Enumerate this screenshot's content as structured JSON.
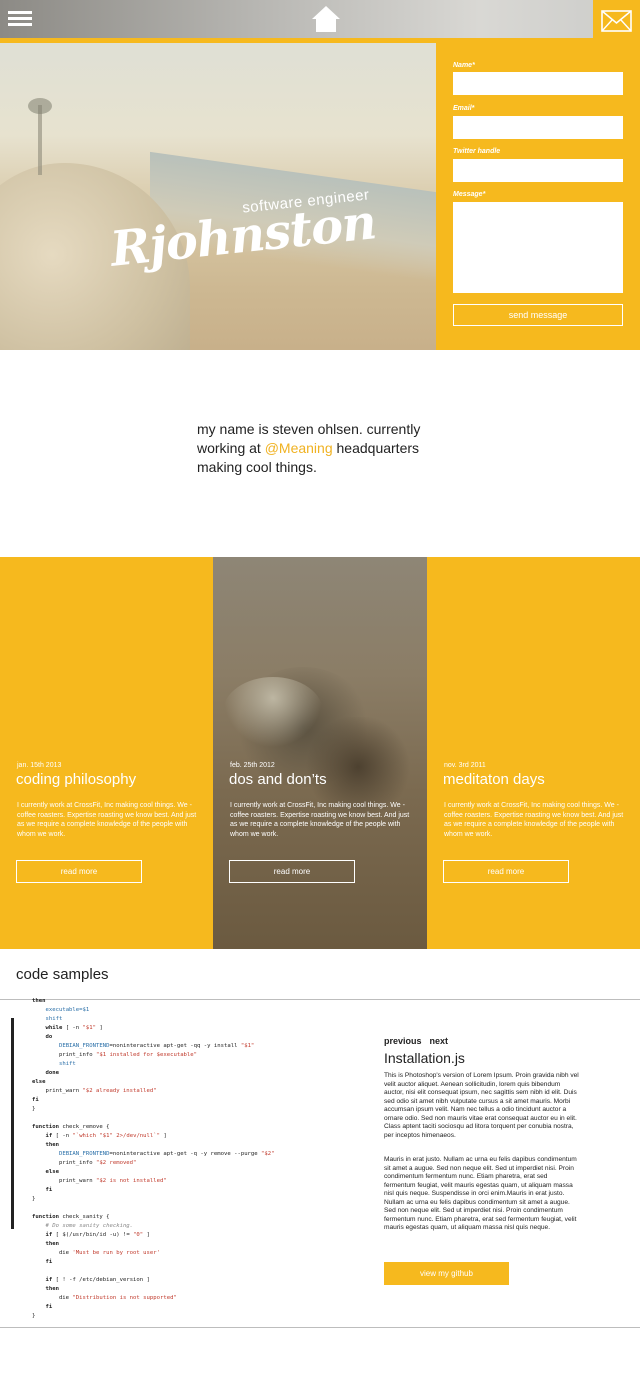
{
  "colors": {
    "accent": "#f6b91e",
    "mention": "#f0b222"
  },
  "topbar": {
    "menu_icon": "hamburger-icon",
    "home_icon": "home-icon",
    "mail_icon": "envelope-icon"
  },
  "hero": {
    "logo_name": "Rjohnston",
    "logo_subtitle": "software engineer"
  },
  "contact_form": {
    "name_label": "Name*",
    "email_label": "Email*",
    "twitter_label": "Twitter handle",
    "message_label": "Message*",
    "name_value": "",
    "email_value": "",
    "twitter_value": "",
    "message_value": "",
    "send_label": "send message"
  },
  "intro": {
    "text_before": "my name is steven ohlsen. currently working at ",
    "mention": "@Meaning",
    "text_after": " headquarters making cool things."
  },
  "posts": [
    {
      "date": "jan. 15th 2013",
      "title": "coding philosophy",
      "text": "I currently work at CrossFit, Inc making cool things. We - coffee roasters. Expertise roasting we know best. And just as we require a complete knowledge of the people with whom we work.",
      "button": "read more"
    },
    {
      "date": "feb. 25th 2012",
      "title": "dos and don’ts",
      "text": "I currently work at CrossFit, Inc making cool things. We - coffee roasters. Expertise roasting we know best. And just as we require a complete knowledge of the people with whom we work.",
      "button": "read more"
    },
    {
      "date": "nov. 3rd 2011",
      "title": "meditaton days",
      "text": "I currently work at CrossFit, Inc making cool things. We - coffee roasters. Expertise roasting we know best. And just as we require a complete knowledge of the people with whom we work.",
      "button": "read more"
    }
  ],
  "code_samples": {
    "heading": "code samples",
    "lines": [
      [
        [
          "kw",
          "then"
        ]
      ],
      [
        [
          "",
          "    "
        ],
        [
          "var",
          "executable=$1"
        ]
      ],
      [
        [
          "",
          "    "
        ],
        [
          "var",
          "shift"
        ]
      ],
      [
        [
          "",
          "    "
        ],
        [
          "kw",
          "while"
        ],
        [
          "",
          " [ -n "
        ],
        [
          "str",
          "\"$1\""
        ],
        [
          "",
          " ]"
        ]
      ],
      [
        [
          "",
          "    "
        ],
        [
          "kw",
          "do"
        ]
      ],
      [
        [
          "",
          "        "
        ],
        [
          "var",
          "DEBIAN_FRONTEND"
        ],
        [
          "",
          "=noninteractive apt-get -qq -y install "
        ],
        [
          "str",
          "\"$1\""
        ]
      ],
      [
        [
          "",
          "        print_info "
        ],
        [
          "str",
          "\"$1 installed for $executable\""
        ]
      ],
      [
        [
          "",
          "        "
        ],
        [
          "var",
          "shift"
        ]
      ],
      [
        [
          "",
          "    "
        ],
        [
          "kw",
          "done"
        ]
      ],
      [
        [
          "kw",
          "else"
        ]
      ],
      [
        [
          "",
          "    print_warn "
        ],
        [
          "str",
          "\"$2 already installed\""
        ]
      ],
      [
        [
          "kw",
          "fi"
        ]
      ],
      [
        [
          "",
          "}"
        ]
      ],
      [
        [
          "",
          ""
        ]
      ],
      [
        [
          "kw",
          "function"
        ],
        [
          "",
          " check_remove {"
        ]
      ],
      [
        [
          "",
          "    "
        ],
        [
          "kw",
          "if"
        ],
        [
          "",
          " [ -n "
        ],
        [
          "str",
          "\"`which \"$1\" 2>/dev/null`\""
        ],
        [
          "",
          " ]"
        ]
      ],
      [
        [
          "",
          "    "
        ],
        [
          "kw",
          "then"
        ]
      ],
      [
        [
          "",
          "        "
        ],
        [
          "var",
          "DEBIAN_FRONTEND"
        ],
        [
          "",
          "=noninteractive apt-get -q -y remove --purge "
        ],
        [
          "str",
          "\"$2\""
        ]
      ],
      [
        [
          "",
          "        print_info "
        ],
        [
          "str",
          "\"$2 removed\""
        ]
      ],
      [
        [
          "",
          "    "
        ],
        [
          "kw",
          "else"
        ]
      ],
      [
        [
          "",
          "        print_warn "
        ],
        [
          "str",
          "\"$2 is not installed\""
        ]
      ],
      [
        [
          "",
          "    "
        ],
        [
          "kw",
          "fi"
        ]
      ],
      [
        [
          "",
          "}"
        ]
      ],
      [
        [
          "",
          ""
        ]
      ],
      [
        [
          "kw",
          "function"
        ],
        [
          "",
          " check_sanity {"
        ]
      ],
      [
        [
          "",
          "    "
        ],
        [
          "cm",
          "# Do some sanity checking."
        ]
      ],
      [
        [
          "",
          "    "
        ],
        [
          "kw",
          "if"
        ],
        [
          "",
          " [ $(/usr/bin/id -u) != "
        ],
        [
          "str",
          "\"0\""
        ],
        [
          "",
          " ]"
        ]
      ],
      [
        [
          "",
          "    "
        ],
        [
          "kw",
          "then"
        ]
      ],
      [
        [
          "",
          "        die "
        ],
        [
          "str",
          "'Must be run by root user'"
        ]
      ],
      [
        [
          "",
          "    "
        ],
        [
          "kw",
          "fi"
        ]
      ],
      [
        [
          "",
          ""
        ]
      ],
      [
        [
          "",
          "    "
        ],
        [
          "kw",
          "if"
        ],
        [
          "",
          " [ ! -f /etc/debian_version ]"
        ]
      ],
      [
        [
          "",
          "    "
        ],
        [
          "kw",
          "then"
        ]
      ],
      [
        [
          "",
          "        die "
        ],
        [
          "str",
          "\"Distribution is not supported\""
        ]
      ],
      [
        [
          "",
          "    "
        ],
        [
          "kw",
          "fi"
        ]
      ],
      [
        [
          "",
          "}"
        ]
      ]
    ]
  },
  "doc": {
    "prev_label": "previous",
    "next_label": "next",
    "title": "Installation.js",
    "para1": "This is Photoshop's version  of Lorem Ipsum. Proin gravida nibh vel velit auctor aliquet. Aenean sollicitudin, lorem quis bibendum auctor, nisi elit consequat ipsum, nec sagittis sem nibh id elit. Duis sed odio sit amet nibh vulputate cursus a sit amet mauris. Morbi accumsan ipsum velit. Nam nec tellus a odio tincidunt auctor a ornare odio. Sed non  mauris vitae erat consequat auctor eu in elit. Class aptent taciti sociosqu ad litora torquent per conubia nostra, per inceptos himenaeos.",
    "para2": "Mauris in erat justo. Nullam ac urna eu felis dapibus condimentum sit amet a augue. Sed non neque elit. Sed ut imperdiet nisi. Proin condimentum fermentum nunc. Etiam pharetra, erat sed fermentum feugiat, velit mauris egestas quam, ut aliquam massa nisl quis neque. Suspendisse in orci enim.Mauris in erat justo. Nullam ac urna eu felis dapibus condimentum sit amet a augue. Sed non neque elit. Sed ut imperdiet nisi. Proin condimentum fermentum nunc. Etiam pharetra, erat sed fermentum feugiat, velit mauris egestas quam, ut aliquam massa nisl quis neque.",
    "github_button": "view my github"
  }
}
